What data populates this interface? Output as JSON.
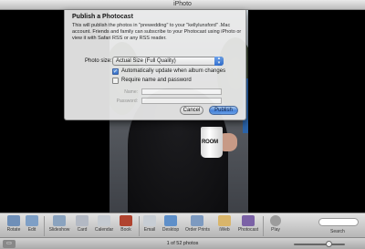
{
  "window": {
    "title": "iPhoto"
  },
  "dialog": {
    "heading": "Publish a Photocast",
    "description": "This will publish the photos in \"prewedding\" to your \"kellylunsford\" .Mac account. Friends and family can subscribe to your Photocast using iPhoto or view it with Safari RSS or any RSS reader.",
    "photo_size_label": "Photo size:",
    "photo_size_value": "Actual Size (Full Quality)",
    "auto_update_label": "Automatically update when album changes",
    "auto_update_checked": true,
    "require_login_label": "Require name and password",
    "require_login_checked": false,
    "name_label": "Name:",
    "password_label": "Password:",
    "name_value": "",
    "password_value": "",
    "cancel_label": "Cancel",
    "publish_label": "Publish"
  },
  "photo": {
    "cup_text": "ROOM"
  },
  "toolbar": {
    "tools": [
      {
        "label": "Rotate",
        "icon": "rotate-icon",
        "color": "#6f8fb8"
      },
      {
        "label": "Edit",
        "icon": "edit-icon",
        "color": "#7e9fc6"
      },
      {
        "label": "Slideshow",
        "icon": "slideshow-icon",
        "color": "#8aa3bf"
      },
      {
        "label": "Card",
        "icon": "card-icon",
        "color": "#b3b9c4"
      },
      {
        "label": "Calendar",
        "icon": "calendar-icon",
        "color": "#c5cbd2"
      },
      {
        "label": "Book",
        "icon": "book-icon",
        "color": "#b0432f"
      },
      {
        "label": "Email",
        "icon": "email-icon",
        "color": "#c7cdd4"
      },
      {
        "label": "Desktop",
        "icon": "desktop-icon",
        "color": "#5e8fc9"
      },
      {
        "label": "Order Prints",
        "icon": "order-prints-icon",
        "color": "#7d9ac0"
      },
      {
        "label": "iWeb",
        "icon": "iweb-icon",
        "color": "#d9b56a"
      },
      {
        "label": "Photocast",
        "icon": "photocast-icon",
        "color": "#7b62a6"
      },
      {
        "label": "Play",
        "icon": "play-icon",
        "color": "#9c9c9c"
      }
    ],
    "search_label": "Search"
  },
  "status": {
    "count_text": "1 of 52 photos",
    "zoom_level": 0.68
  }
}
